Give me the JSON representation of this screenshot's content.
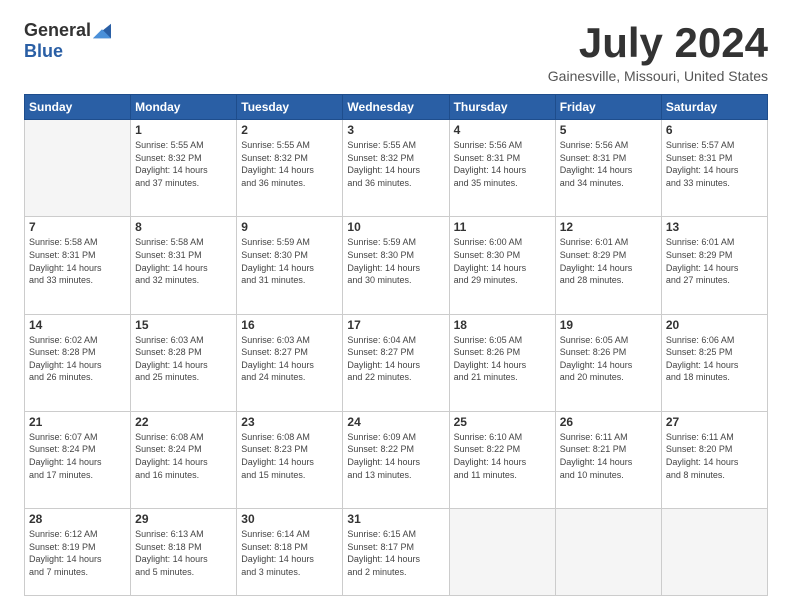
{
  "logo": {
    "general": "General",
    "blue": "Blue"
  },
  "title": "July 2024",
  "subtitle": "Gainesville, Missouri, United States",
  "days_of_week": [
    "Sunday",
    "Monday",
    "Tuesday",
    "Wednesday",
    "Thursday",
    "Friday",
    "Saturday"
  ],
  "weeks": [
    [
      {
        "day": "",
        "info": ""
      },
      {
        "day": "1",
        "info": "Sunrise: 5:55 AM\nSunset: 8:32 PM\nDaylight: 14 hours\nand 37 minutes."
      },
      {
        "day": "2",
        "info": "Sunrise: 5:55 AM\nSunset: 8:32 PM\nDaylight: 14 hours\nand 36 minutes."
      },
      {
        "day": "3",
        "info": "Sunrise: 5:55 AM\nSunset: 8:32 PM\nDaylight: 14 hours\nand 36 minutes."
      },
      {
        "day": "4",
        "info": "Sunrise: 5:56 AM\nSunset: 8:31 PM\nDaylight: 14 hours\nand 35 minutes."
      },
      {
        "day": "5",
        "info": "Sunrise: 5:56 AM\nSunset: 8:31 PM\nDaylight: 14 hours\nand 34 minutes."
      },
      {
        "day": "6",
        "info": "Sunrise: 5:57 AM\nSunset: 8:31 PM\nDaylight: 14 hours\nand 33 minutes."
      }
    ],
    [
      {
        "day": "7",
        "info": "Sunrise: 5:58 AM\nSunset: 8:31 PM\nDaylight: 14 hours\nand 33 minutes."
      },
      {
        "day": "8",
        "info": "Sunrise: 5:58 AM\nSunset: 8:31 PM\nDaylight: 14 hours\nand 32 minutes."
      },
      {
        "day": "9",
        "info": "Sunrise: 5:59 AM\nSunset: 8:30 PM\nDaylight: 14 hours\nand 31 minutes."
      },
      {
        "day": "10",
        "info": "Sunrise: 5:59 AM\nSunset: 8:30 PM\nDaylight: 14 hours\nand 30 minutes."
      },
      {
        "day": "11",
        "info": "Sunrise: 6:00 AM\nSunset: 8:30 PM\nDaylight: 14 hours\nand 29 minutes."
      },
      {
        "day": "12",
        "info": "Sunrise: 6:01 AM\nSunset: 8:29 PM\nDaylight: 14 hours\nand 28 minutes."
      },
      {
        "day": "13",
        "info": "Sunrise: 6:01 AM\nSunset: 8:29 PM\nDaylight: 14 hours\nand 27 minutes."
      }
    ],
    [
      {
        "day": "14",
        "info": "Sunrise: 6:02 AM\nSunset: 8:28 PM\nDaylight: 14 hours\nand 26 minutes."
      },
      {
        "day": "15",
        "info": "Sunrise: 6:03 AM\nSunset: 8:28 PM\nDaylight: 14 hours\nand 25 minutes."
      },
      {
        "day": "16",
        "info": "Sunrise: 6:03 AM\nSunset: 8:27 PM\nDaylight: 14 hours\nand 24 minutes."
      },
      {
        "day": "17",
        "info": "Sunrise: 6:04 AM\nSunset: 8:27 PM\nDaylight: 14 hours\nand 22 minutes."
      },
      {
        "day": "18",
        "info": "Sunrise: 6:05 AM\nSunset: 8:26 PM\nDaylight: 14 hours\nand 21 minutes."
      },
      {
        "day": "19",
        "info": "Sunrise: 6:05 AM\nSunset: 8:26 PM\nDaylight: 14 hours\nand 20 minutes."
      },
      {
        "day": "20",
        "info": "Sunrise: 6:06 AM\nSunset: 8:25 PM\nDaylight: 14 hours\nand 18 minutes."
      }
    ],
    [
      {
        "day": "21",
        "info": "Sunrise: 6:07 AM\nSunset: 8:24 PM\nDaylight: 14 hours\nand 17 minutes."
      },
      {
        "day": "22",
        "info": "Sunrise: 6:08 AM\nSunset: 8:24 PM\nDaylight: 14 hours\nand 16 minutes."
      },
      {
        "day": "23",
        "info": "Sunrise: 6:08 AM\nSunset: 8:23 PM\nDaylight: 14 hours\nand 15 minutes."
      },
      {
        "day": "24",
        "info": "Sunrise: 6:09 AM\nSunset: 8:22 PM\nDaylight: 14 hours\nand 13 minutes."
      },
      {
        "day": "25",
        "info": "Sunrise: 6:10 AM\nSunset: 8:22 PM\nDaylight: 14 hours\nand 11 minutes."
      },
      {
        "day": "26",
        "info": "Sunrise: 6:11 AM\nSunset: 8:21 PM\nDaylight: 14 hours\nand 10 minutes."
      },
      {
        "day": "27",
        "info": "Sunrise: 6:11 AM\nSunset: 8:20 PM\nDaylight: 14 hours\nand 8 minutes."
      }
    ],
    [
      {
        "day": "28",
        "info": "Sunrise: 6:12 AM\nSunset: 8:19 PM\nDaylight: 14 hours\nand 7 minutes."
      },
      {
        "day": "29",
        "info": "Sunrise: 6:13 AM\nSunset: 8:18 PM\nDaylight: 14 hours\nand 5 minutes."
      },
      {
        "day": "30",
        "info": "Sunrise: 6:14 AM\nSunset: 8:18 PM\nDaylight: 14 hours\nand 3 minutes."
      },
      {
        "day": "31",
        "info": "Sunrise: 6:15 AM\nSunset: 8:17 PM\nDaylight: 14 hours\nand 2 minutes."
      },
      {
        "day": "",
        "info": ""
      },
      {
        "day": "",
        "info": ""
      },
      {
        "day": "",
        "info": ""
      }
    ]
  ]
}
